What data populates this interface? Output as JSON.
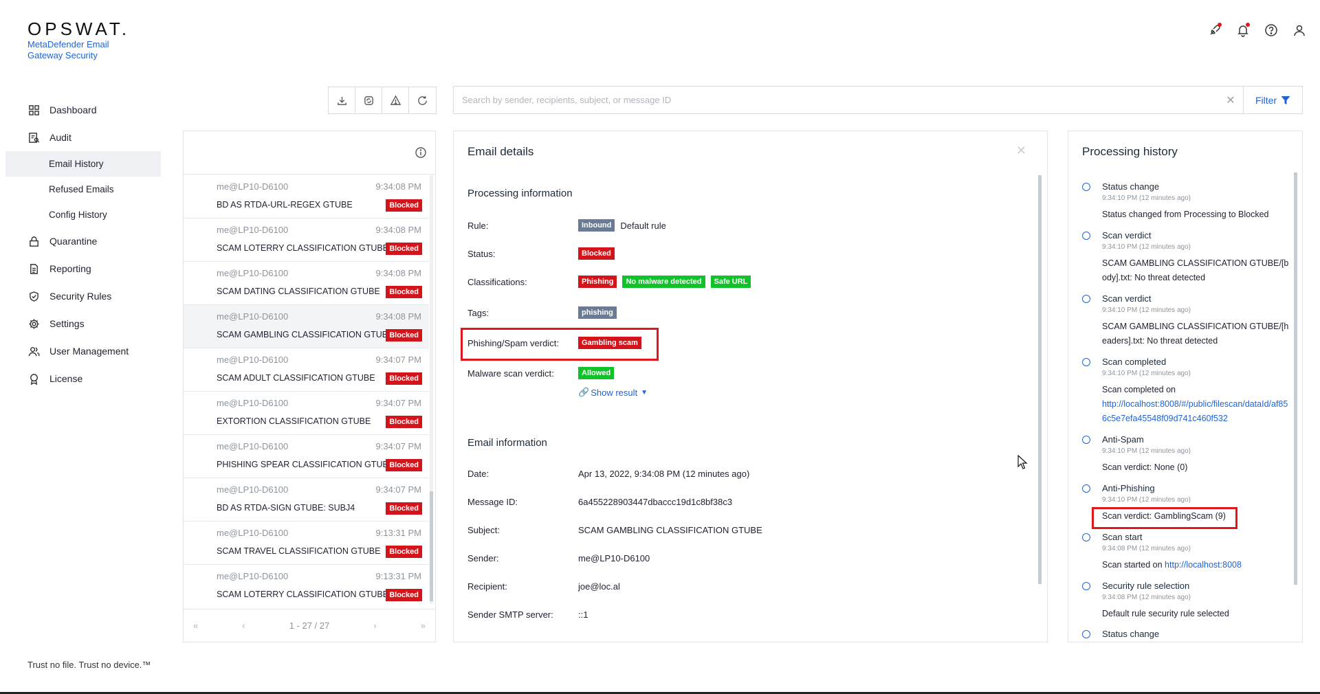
{
  "brand": {
    "logo": "OPSWAT.",
    "product": "MetaDefender Email Gateway Security"
  },
  "header_icons": [
    "integration-icon",
    "bell-icon",
    "help-icon",
    "user-icon"
  ],
  "nav": {
    "items": [
      {
        "label": "Dashboard",
        "icon": "grid-icon"
      },
      {
        "label": "Audit",
        "icon": "audit-icon"
      },
      {
        "label": "Email History",
        "sub": true,
        "active": true
      },
      {
        "label": "Refused Emails",
        "sub": true
      },
      {
        "label": "Config History",
        "sub": true
      },
      {
        "label": "Quarantine",
        "icon": "lock-icon"
      },
      {
        "label": "Reporting",
        "icon": "document-icon"
      },
      {
        "label": "Security Rules",
        "icon": "shield-icon"
      },
      {
        "label": "Settings",
        "icon": "gear-icon"
      },
      {
        "label": "User Management",
        "icon": "users-icon"
      },
      {
        "label": "License",
        "icon": "award-icon"
      }
    ]
  },
  "footer": "Trust no file. Trust no device.™",
  "search": {
    "placeholder": "Search by sender, recipients, subject, or message ID",
    "filter_label": "Filter"
  },
  "list": {
    "rows": [
      {
        "sender": "me@LP10-D6100",
        "time": "9:34:08 PM",
        "subject": "BD AS RTDA-URL-REGEX GTUBE",
        "status": "Blocked"
      },
      {
        "sender": "me@LP10-D6100",
        "time": "9:34:08 PM",
        "subject": "SCAM LOTERRY CLASSIFICATION GTUBE",
        "status": "Blocked"
      },
      {
        "sender": "me@LP10-D6100",
        "time": "9:34:08 PM",
        "subject": "SCAM DATING CLASSIFICATION GTUBE",
        "status": "Blocked"
      },
      {
        "sender": "me@LP10-D6100",
        "time": "9:34:08 PM",
        "subject": "SCAM GAMBLING CLASSIFICATION GTUBE",
        "status": "Blocked",
        "selected": true
      },
      {
        "sender": "me@LP10-D6100",
        "time": "9:34:07 PM",
        "subject": "SCAM ADULT CLASSIFICATION GTUBE",
        "status": "Blocked"
      },
      {
        "sender": "me@LP10-D6100",
        "time": "9:34:07 PM",
        "subject": "EXTORTION CLASSIFICATION GTUBE",
        "status": "Blocked"
      },
      {
        "sender": "me@LP10-D6100",
        "time": "9:34:07 PM",
        "subject": "PHISHING SPEAR CLASSIFICATION GTUBE",
        "status": "Blocked"
      },
      {
        "sender": "me@LP10-D6100",
        "time": "9:34:07 PM",
        "subject": "BD AS RTDA-SIGN GTUBE: SUBJ4",
        "status": "Blocked"
      },
      {
        "sender": "me@LP10-D6100",
        "time": "9:13:31 PM",
        "subject": "SCAM TRAVEL CLASSIFICATION GTUBE",
        "status": "Blocked"
      },
      {
        "sender": "me@LP10-D6100",
        "time": "9:13:31 PM",
        "subject": "SCAM LOTERRY CLASSIFICATION GTUBE",
        "status": "Blocked"
      }
    ],
    "pager": "1 - 27 / 27"
  },
  "details": {
    "title": "Email details",
    "processing_title": "Processing information",
    "rule_label": "Rule:",
    "rule_badge": "Inbound",
    "rule_value": "Default rule",
    "status_label": "Status:",
    "status_value": "Blocked",
    "class_label": "Classifications:",
    "class_values": [
      "Phishing",
      "No malware detected",
      "Safe URL"
    ],
    "tags_label": "Tags:",
    "tags_value": "phishing",
    "spam_label": "Phishing/Spam verdict:",
    "spam_value": "Gambling scam",
    "malware_label": "Malware scan verdict:",
    "malware_value": "Allowed",
    "show_result": "Show result",
    "email_title": "Email information",
    "date_label": "Date:",
    "date_value": "Apr 13, 2022, 9:34:08 PM (12 minutes ago)",
    "msgid_label": "Message ID:",
    "msgid_value": "6a455228903447dbaccc19d1c8bf38c3",
    "subject_label": "Subject:",
    "subject_value": "SCAM GAMBLING CLASSIFICATION GTUBE",
    "sender_label": "Sender:",
    "sender_value": "me@LP10-D6100",
    "recipient_label": "Recipient:",
    "recipient_value": "joe@loc.al",
    "smtp_label": "Sender SMTP server:",
    "smtp_value": "::1"
  },
  "history": {
    "title": "Processing history",
    "items": [
      {
        "title": "Status change",
        "meta": "9:34:10 PM (12 minutes ago)",
        "desc": "Status changed from Processing to Blocked"
      },
      {
        "title": "Scan verdict",
        "meta": "9:34:10 PM (12 minutes ago)",
        "desc": "SCAM GAMBLING CLASSIFICATION GTUBE/[body].txt: No threat detected"
      },
      {
        "title": "Scan verdict",
        "meta": "9:34:10 PM (12 minutes ago)",
        "desc": "SCAM GAMBLING CLASSIFICATION GTUBE/[headers].txt: No threat detected"
      },
      {
        "title": "Scan completed",
        "meta": "9:34:10 PM (12 minutes ago)",
        "desc": "Scan completed on",
        "link": "http://localhost:8008/#/public/filescan/dataId/af856c5e7efa45548f09d741c460f532"
      },
      {
        "title": "Anti-Spam",
        "meta": "9:34:10 PM (12 minutes ago)",
        "desc": "Scan verdict: None (0)"
      },
      {
        "title": "Anti-Phishing",
        "meta": "9:34:10 PM (12 minutes ago)",
        "desc": "Scan verdict: GamblingScam (9)"
      },
      {
        "title": "Scan start",
        "meta": "9:34:08 PM (12 minutes ago)",
        "desc": "Scan started on",
        "link": "http://localhost:8008"
      },
      {
        "title": "Security rule selection",
        "meta": "9:34:08 PM (12 minutes ago)",
        "desc": "Default rule security rule selected"
      },
      {
        "title": "Status change",
        "meta": "",
        "desc": ""
      }
    ]
  },
  "colors": {
    "accent": "#1d63d6",
    "blocked": "#d4141b",
    "allowed": "#12c22a",
    "tag": "#6a7b95",
    "highlight": "#e0181d"
  }
}
